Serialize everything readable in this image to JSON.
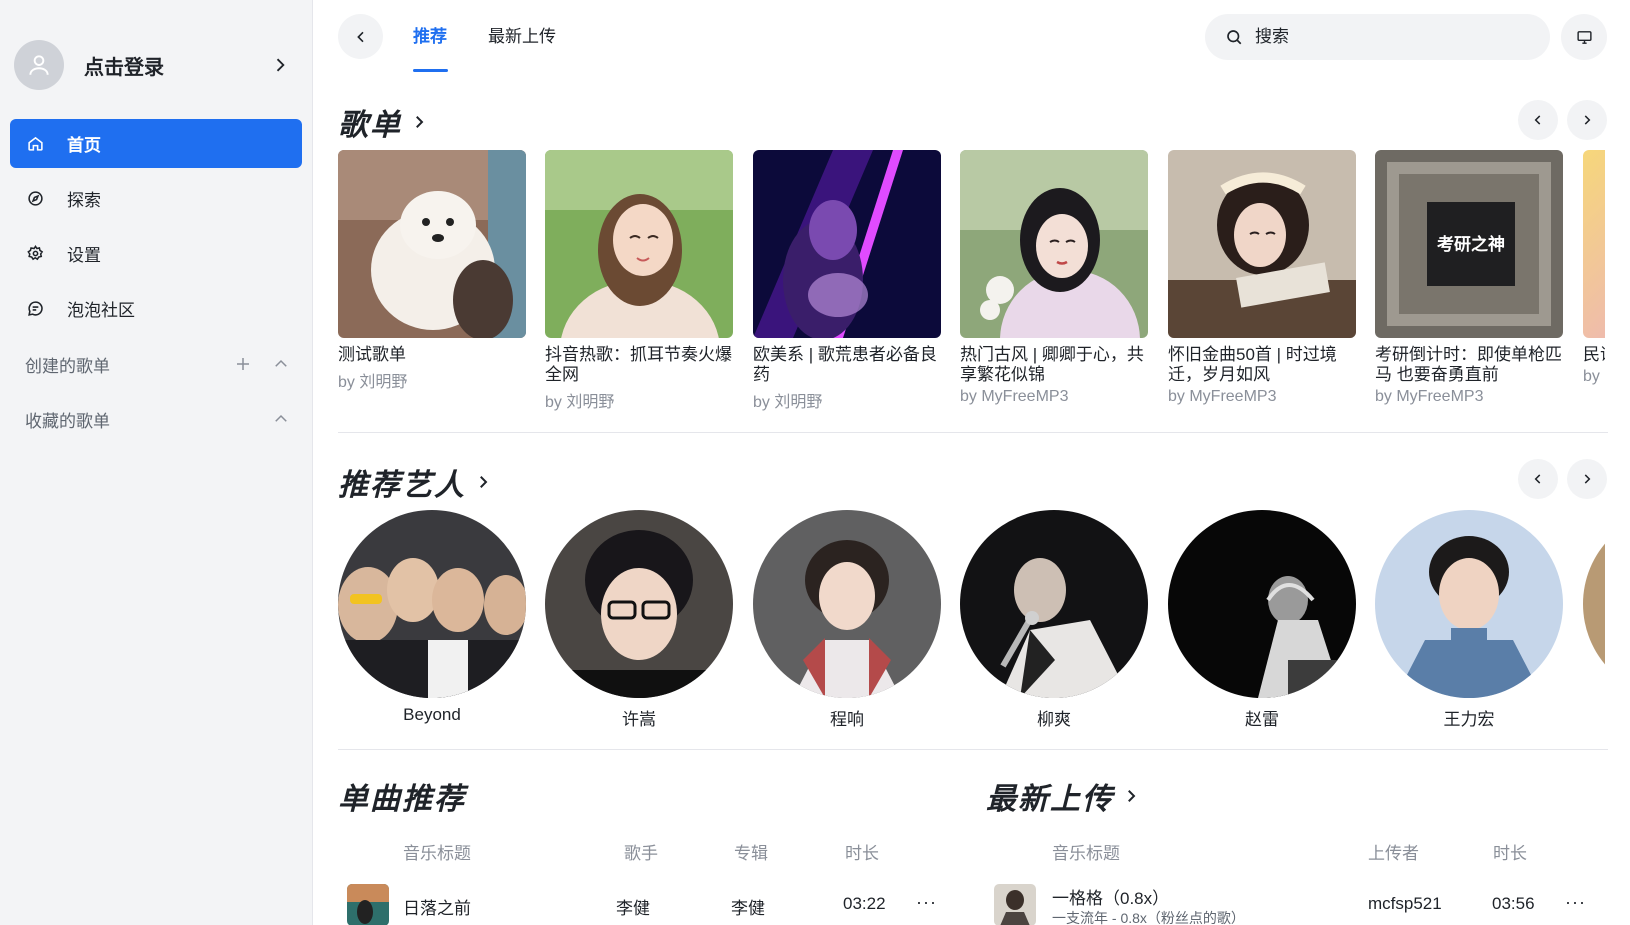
{
  "sidebar": {
    "login_label": "点击登录",
    "nav": [
      {
        "label": "首页",
        "icon": "home-icon",
        "active": true
      },
      {
        "label": "探索",
        "icon": "compass-icon",
        "active": false
      },
      {
        "label": "设置",
        "icon": "gear-icon",
        "active": false
      },
      {
        "label": "泡泡社区",
        "icon": "chat-bubble-icon",
        "active": false
      }
    ],
    "created_playlists_label": "创建的歌单",
    "collected_playlists_label": "收藏的歌单"
  },
  "topbar": {
    "tabs": [
      {
        "label": "推荐",
        "active": true
      },
      {
        "label": "最新上传",
        "active": false
      }
    ],
    "search_placeholder": "搜索"
  },
  "playlists": {
    "heading": "歌单",
    "items": [
      {
        "title": "测试歌单",
        "by": "by 刘明野"
      },
      {
        "title": "抖音热歌：抓耳节奏火爆全网",
        "by": "by 刘明野"
      },
      {
        "title": "欧美系 | 歌荒患者必备良药",
        "by": "by 刘明野"
      },
      {
        "title": "热门古风 | 卿卿于心，共享繁花似锦",
        "by": "by MyFreeMP3"
      },
      {
        "title": "怀旧金曲50首 | 时过境迁，岁月如风",
        "by": "by MyFreeMP3"
      },
      {
        "title": "考研倒计时：即使单枪匹马 也要奋勇直前",
        "by": "by MyFreeMP3"
      },
      {
        "title": "民谣",
        "by": "by"
      }
    ],
    "cover_text_6": "考研之神"
  },
  "artists": {
    "heading": "推荐艺人",
    "items": [
      "Beyond",
      "许嵩",
      "程响",
      "柳爽",
      "赵雷",
      "王力宏"
    ]
  },
  "singles": {
    "heading": "单曲推荐",
    "columns": {
      "title": "音乐标题",
      "artist": "歌手",
      "album": "专辑",
      "duration": "时长"
    },
    "rows": [
      {
        "title": "日落之前",
        "artist": "李健",
        "album": "李健",
        "duration": "03:22",
        "more": "···"
      }
    ]
  },
  "latest": {
    "heading": "最新上传",
    "columns": {
      "title": "音乐标题",
      "uploader": "上传者",
      "duration": "时长"
    },
    "rows": [
      {
        "title": "一格格（0.8x）",
        "subtitle": "一支流年 - 0.8x（粉丝点的歌）",
        "uploader": "mcfsp521",
        "duration": "03:56",
        "more": "···"
      }
    ]
  },
  "colors": {
    "accent": "#1f6ff0",
    "sidebar_bg": "#f3f4f6",
    "muted_text": "#8a8f99"
  }
}
